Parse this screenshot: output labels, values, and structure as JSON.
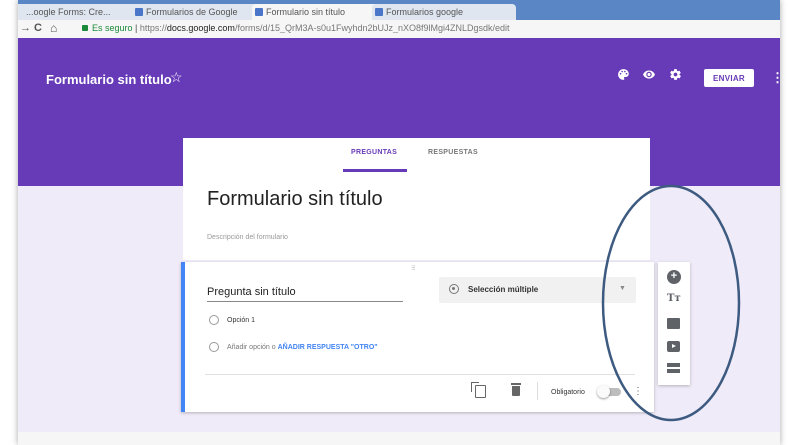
{
  "browser": {
    "tabs": [
      {
        "label": "...oogle Forms: Cre..."
      },
      {
        "label": "Formularios de Google"
      },
      {
        "label": "Formulario sin título"
      },
      {
        "label": "Formularios google"
      }
    ],
    "nav": {
      "back": "←",
      "forward": "→",
      "reload": "C",
      "home": "⌂"
    },
    "url": {
      "secure": "Es seguro",
      "separator": " | ",
      "scheme": "https://",
      "domain": "docs.google.com",
      "path": "/forms/d/15_QrM3A-s0u1Fwyhdn2bUJz_nXO8f9lMgi4ZNLDgsdk/edit"
    }
  },
  "header": {
    "title": "Formulario sin título",
    "star_icon": "☆",
    "icons": [
      "palette-icon",
      "eye-icon",
      "gear-icon"
    ],
    "send_label": "ENVIAR",
    "more_icon": "⋮",
    "accent": "#673ab7"
  },
  "form_tabs": [
    {
      "label": "PREGUNTAS",
      "active": true
    },
    {
      "label": "RESPUESTAS",
      "active": false
    }
  ],
  "form": {
    "title": "Formulario sin título",
    "description_placeholder": "Descripción del formulario"
  },
  "question": {
    "drag_handle": "⁝⁝⁝",
    "title": "Pregunta sin título",
    "type": "Selección múltiple",
    "type_arrow": "▼",
    "option1": "Opción 1",
    "add_option": "Añadir opción",
    "or": "o",
    "add_other": "AÑADIR RESPUESTA \"OTRO\"",
    "required_label": "Obligatorio",
    "required": false,
    "more_icon": "⋮"
  },
  "side_toolbar": {
    "tools": [
      "add-question-icon",
      "add-title-icon",
      "add-image-icon",
      "add-video-icon",
      "add-section-icon"
    ],
    "title_glyph": "Tт",
    "plus_glyph": "+"
  }
}
